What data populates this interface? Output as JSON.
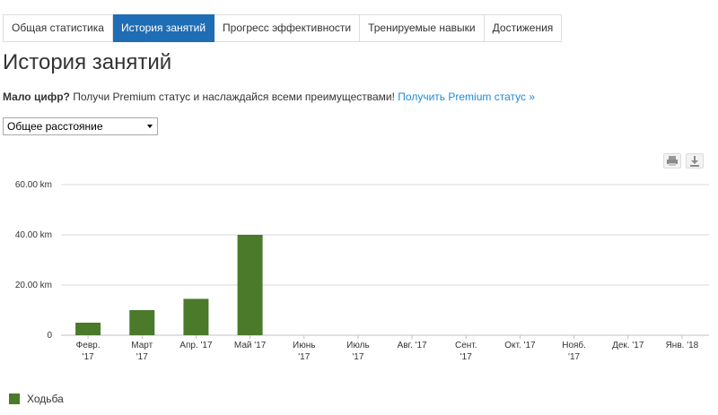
{
  "tabs": [
    {
      "label": "Общая статистика",
      "active": false
    },
    {
      "label": "История занятий",
      "active": true
    },
    {
      "label": "Прогресс эффективности",
      "active": false
    },
    {
      "label": "Тренируемые навыки",
      "active": false
    },
    {
      "label": "Достижения",
      "active": false
    }
  ],
  "page_title": "История занятий",
  "promo": {
    "bold": "Мало цифр?",
    "text": " Получи Premium статус и наслаждайся всеми преимуществами! ",
    "link": "Получить Premium статус »"
  },
  "metric_select": {
    "value": "Общее расстояние"
  },
  "toolbar": {
    "print_icon": "printer-icon",
    "download_icon": "download-icon"
  },
  "colors": {
    "accent": "#1f6db4",
    "link": "#1f8ad3",
    "bar": "#4a7a2a",
    "grid": "#d8d8d8"
  },
  "chart_data": {
    "type": "bar",
    "categories": [
      [
        "Февр.",
        "'17"
      ],
      [
        "Март",
        "'17"
      ],
      [
        "Апр. '17"
      ],
      [
        "Май '17"
      ],
      [
        "Июнь",
        "'17"
      ],
      [
        "Июль",
        "'17"
      ],
      [
        "Авг. '17"
      ],
      [
        "Сент.",
        "'17"
      ],
      [
        "Окт. '17"
      ],
      [
        "Нояб.",
        "'17"
      ],
      [
        "Дек. '17"
      ],
      [
        "Янв. '18"
      ]
    ],
    "series": [
      {
        "name": "Ходьба",
        "color": "#4a7a2a",
        "values": [
          5,
          10,
          14.5,
          40,
          0,
          0,
          0,
          0,
          0,
          0,
          0,
          0
        ]
      }
    ],
    "yticks": [
      "60.00 km",
      "40.00 km",
      "20.00 km",
      "0"
    ],
    "ytick_values": [
      60,
      40,
      20,
      0
    ],
    "ylim": [
      0,
      60
    ],
    "grid": true,
    "legend_position": "bottom-left"
  }
}
